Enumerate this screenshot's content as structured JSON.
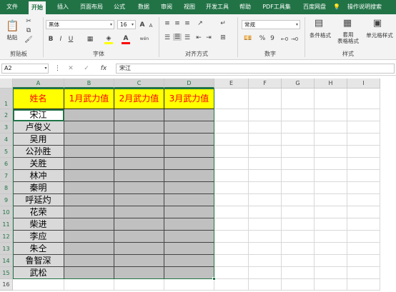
{
  "tabs": [
    "文件",
    "开始",
    "插入",
    "页面布局",
    "公式",
    "数据",
    "审阅",
    "视图",
    "开发工具",
    "帮助",
    "PDF工具集",
    "百度网盘",
    "操作说明搜索"
  ],
  "active_tab": "开始",
  "ribbon": {
    "clipboard": {
      "paste": "粘贴",
      "label": "剪贴板"
    },
    "font": {
      "family": "黑体",
      "size": "16",
      "bold": "B",
      "italic": "I",
      "underline": "U",
      "grow": "A",
      "shrink": "A",
      "color_letter": "A",
      "wen": "wén",
      "label": "字体"
    },
    "alignment": {
      "label": "对齐方式"
    },
    "number": {
      "format": "常规",
      "percent": "%",
      "comma": "9",
      "label": "数字"
    },
    "styles": {
      "conditional": "条件格式",
      "table": "套用\n表格格式",
      "cell_styles": "单元格样式",
      "label": "样式"
    }
  },
  "formula_bar": {
    "name_box": "A2",
    "fx": "fx",
    "value": "宋江"
  },
  "columns": [
    "A",
    "B",
    "C",
    "D",
    "E",
    "F",
    "G",
    "H",
    "I"
  ],
  "rows": [
    "1",
    "2",
    "3",
    "4",
    "5",
    "6",
    "7",
    "8",
    "9",
    "10",
    "11",
    "12",
    "13",
    "14",
    "15",
    "16"
  ],
  "table": {
    "header": [
      "姓名",
      "1月武力值",
      "2月武力值",
      "3月武力值"
    ],
    "names": [
      "宋江",
      "卢俊义",
      "吴用",
      "公孙胜",
      "关胜",
      "林冲",
      "秦明",
      "呼延灼",
      "花荣",
      "柴进",
      "李应",
      "朱仝",
      "鲁智深",
      "武松"
    ]
  },
  "colors": {
    "accent": "#217346",
    "header_fill": "#ffff00",
    "header_text": "#ff0000",
    "name_fill": "#d9d9d9",
    "data_fill": "#c0c0c0"
  }
}
